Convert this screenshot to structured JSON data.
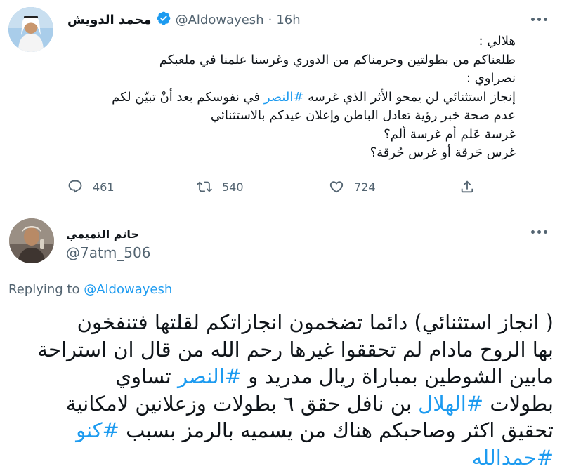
{
  "tweet1": {
    "author_name": "محمد الدويش",
    "handle": "@Aldowayesh",
    "separator": "·",
    "time": "16h",
    "lines": [
      "هلالي :",
      "طلعناكم من بطولتين وحرمناكم من الدوري وغرسنا علمنا في ملعبكم",
      "نصراوي :",
      "إنجاز استثنائي لن يمحو الأثر الذي غرسه",
      "#النصر",
      "في نفوسكم بعد أنْ تبيّن لكم",
      "عدم صحة خبر رؤية تعادل الباطن وإعلان عيدكم بالاستثنائي",
      "غرسة عَلم أم غرسة ألم؟",
      "غرس حَرقة أو غرس حُرقة؟"
    ],
    "actions": {
      "replies": "461",
      "retweets": "540",
      "likes": "724"
    }
  },
  "tweet2": {
    "author_name": "حاتم التميمي",
    "handle": "@7atm_506",
    "replying_label": "Replying to",
    "replying_to": "@Aldowayesh",
    "lines": [
      "( انجاز استثنائي) دائما تضخمون انجازاتكم لقلتها فتنفخون",
      "بها الروح مادام لم تحققوا غيرها رحم الله من قال ان استراحة",
      "مابين الشوطين بمباراة ريال مدريد  و",
      "#النصر",
      "تساوي",
      "بطولات",
      "#الهلال",
      "بن نافل حقق ٦ بطولات وزعلانين لامكانية",
      "تحقيق اكثر وصاحبكم هناك من يسميه بالرمز بسبب",
      "#كنو",
      "#حمدالله"
    ]
  },
  "colors": {
    "accent": "#1d9bf0",
    "secondary_text": "#536471",
    "divider": "#eff3f4"
  },
  "icons": [
    "more-icon",
    "verified-badge-icon",
    "reply-icon",
    "retweet-icon",
    "like-icon",
    "share-icon"
  ]
}
